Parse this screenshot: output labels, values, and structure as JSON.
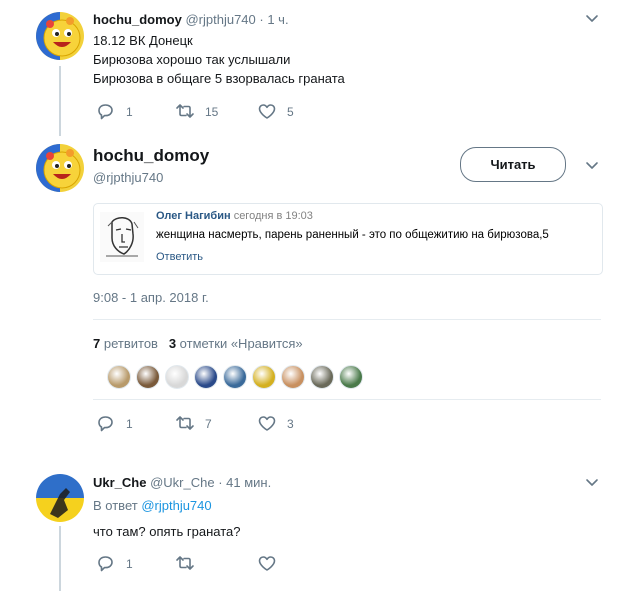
{
  "tweet1": {
    "author_name": "hochu_domoy",
    "author_handle": "@rjpthju740",
    "time": "· 1 ч.",
    "lines": [
      "18.12 ВК Донецк",
      "Бирюзова хорошо так услышали",
      "Бирюзова в общаге 5 взорвалась граната"
    ],
    "replies": "1",
    "retweets": "15",
    "likes": "5"
  },
  "main_tweet": {
    "author_name": "hochu_domoy",
    "author_handle": "@rjpthju740",
    "follow_label": "Читать",
    "quote": {
      "author": "Олег Нагибин",
      "time": "сегодня в 19:03",
      "text": "женщина насмерть, парень раненный - это по общежитию на бирюзова,5",
      "reply_link": "Ответить"
    },
    "timestamp": "9:08 - 1 апр. 2018 г.",
    "stats": {
      "retweet_count": "7",
      "retweet_label": "ретвитов",
      "like_count": "3",
      "like_label": "отметки «Нравится»"
    },
    "likers": [
      {
        "name": "liker-1",
        "color": "#b89a6a"
      },
      {
        "name": "liker-2",
        "color": "#7a5a3a"
      },
      {
        "name": "liker-3",
        "color": "#d8d8d8"
      },
      {
        "name": "liker-4",
        "color": "#2a4a8a"
      },
      {
        "name": "liker-5",
        "color": "#3a6a9a"
      },
      {
        "name": "liker-6",
        "color": "#d4b020"
      },
      {
        "name": "liker-7",
        "color": "#c89060"
      },
      {
        "name": "liker-8",
        "color": "#6a6a5a"
      },
      {
        "name": "liker-9",
        "color": "#4a7a4a"
      }
    ],
    "replies": "1",
    "retweets": "7",
    "likes": "3"
  },
  "reply_tweet": {
    "author_name": "Ukr_Che",
    "author_handle": "@Ukr_Che",
    "time": "· 41 мин.",
    "in_reply_prefix": "В ответ",
    "in_reply_to": "@rjpthju740",
    "text": "что там? опять граната?",
    "replies": "1"
  },
  "colors": {
    "accent": "#1b95e0",
    "muted": "#657786",
    "border": "#e6ecf0"
  }
}
